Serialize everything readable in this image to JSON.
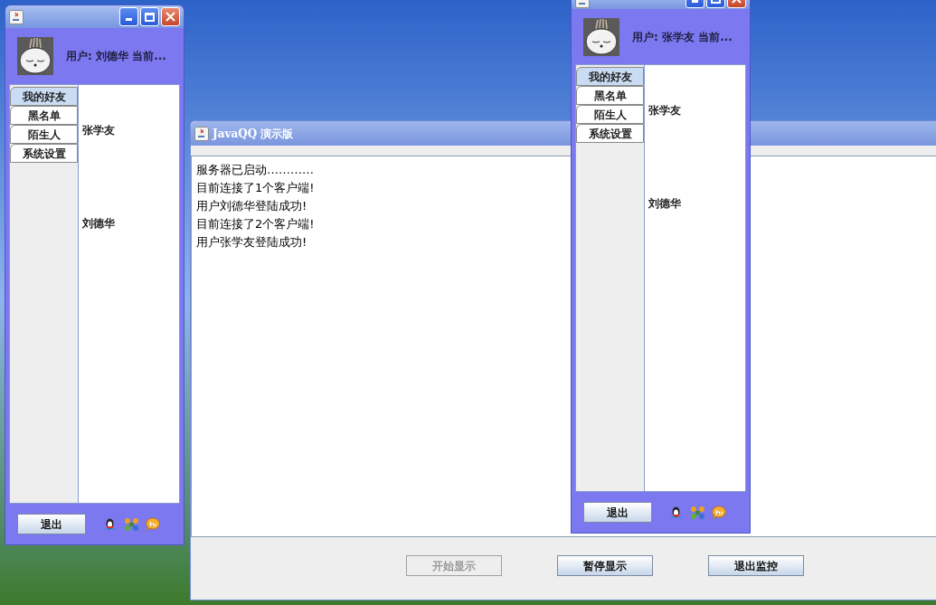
{
  "clients": [
    {
      "user": "用户: 刘德华 当前...",
      "tabs": [
        {
          "label": "我的好友",
          "selected": true
        },
        {
          "label": "黑名单",
          "selected": false
        },
        {
          "label": "陌生人",
          "selected": false
        },
        {
          "label": "系统设置",
          "selected": false
        }
      ],
      "friends": [
        "张学友",
        "刘德华"
      ],
      "exit_button": "退出"
    },
    {
      "user": "用户: 张学友 当前...",
      "tabs": [
        {
          "label": "我的好友",
          "selected": true
        },
        {
          "label": "黑名单",
          "selected": false
        },
        {
          "label": "陌生人",
          "selected": false
        },
        {
          "label": "系统设置",
          "selected": false
        }
      ],
      "friends": [
        "张学友",
        "刘德华"
      ],
      "exit_button": "退出"
    }
  ],
  "server": {
    "title": "JavaQQ 演示版",
    "log": [
      "服务器已启动…………",
      "目前连接了1个客户端!",
      "用户刘德华登陆成功!",
      "目前连接了2个客户端!",
      "用户张学友登陆成功!"
    ],
    "buttons": [
      {
        "label": "开始显示",
        "disabled": true
      },
      {
        "label": "暂停显示",
        "disabled": false
      },
      {
        "label": "退出监控",
        "disabled": false
      }
    ]
  }
}
